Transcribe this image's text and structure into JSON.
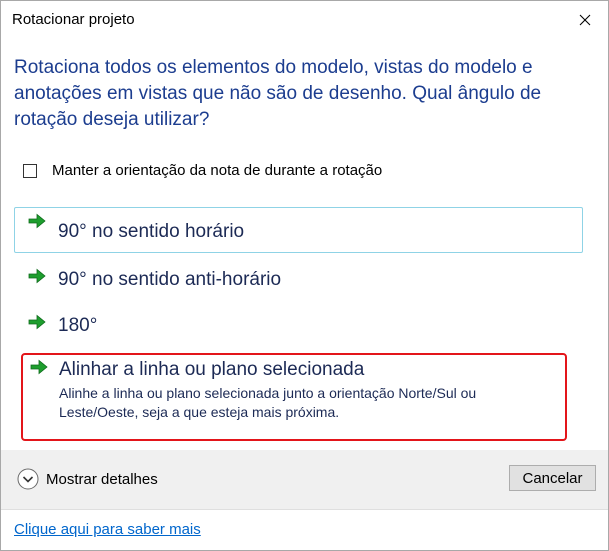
{
  "window": {
    "title": "Rotacionar projeto"
  },
  "main": {
    "instruction": "Rotaciona todos os elementos do modelo, vistas do modelo e anotações em vistas que não são de desenho.  Qual ângulo de rotação deseja utilizar?",
    "verification": {
      "label": "Manter a orientação da nota de durante a rotação",
      "checked": false
    },
    "options": [
      {
        "label": "90° no sentido horário"
      },
      {
        "label": "90° no sentido anti-horário"
      },
      {
        "label": "180°"
      },
      {
        "label": "Alinhar a linha ou plano selecionada",
        "note": "Alinhe a linha ou plano selecionada junto a orientação Norte/Sul ou Leste/Oeste, seja a que esteja mais próxima."
      }
    ]
  },
  "footer": {
    "details_label": "Mostrar detalhes",
    "cancel_label": "Cancelar",
    "help_link": "Clique aqui para saber mais"
  },
  "colors": {
    "instruction_text": "#1c3d8f",
    "arrow_green": "#1e9e2e",
    "highlight_red": "#e3151a",
    "focus_border": "#8fd3e6",
    "link_blue": "#0066cc"
  },
  "icons": {
    "close": "close-icon",
    "option_arrow": "green-arrow-icon",
    "details": "chevron-down-circle-icon"
  }
}
